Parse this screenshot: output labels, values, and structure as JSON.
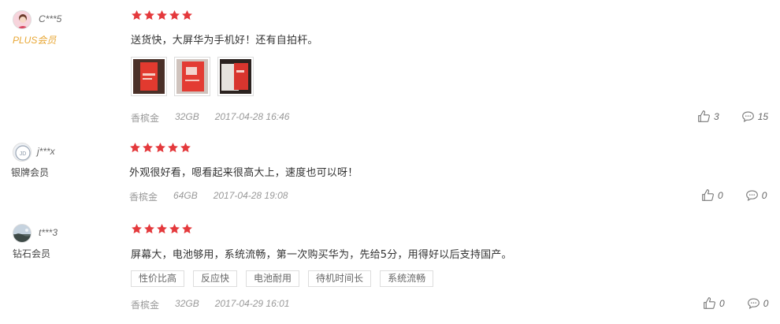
{
  "reviews": [
    {
      "username": "C***5",
      "level": "PLUS会员",
      "stars": 5,
      "comment": "送货快，大屏华为手机好！还有自拍杆。",
      "thumbnails": [
        "photo-1",
        "photo-2",
        "photo-3"
      ],
      "color": "香槟金",
      "storage": "32GB",
      "datetime": "2017-04-28 16:46",
      "likes": "3",
      "replies": "15"
    },
    {
      "username": "j***x",
      "level": "银牌会员",
      "stars": 5,
      "comment": "外观很好看，嗯看起来很高大上，速度也可以呀！",
      "color": "香槟金",
      "storage": "64GB",
      "datetime": "2017-04-28 19:08",
      "likes": "0",
      "replies": "0"
    },
    {
      "username": "t***3",
      "level": "钻石会员",
      "stars": 5,
      "comment": "屏幕大，电池够用，系统流畅，第一次购买华为，先给5分，用得好以后支持国产。",
      "tags": [
        "性价比高",
        "反应快",
        "电池耐用",
        "待机时间长",
        "系统流畅"
      ],
      "color": "香槟金",
      "storage": "32GB",
      "datetime": "2017-04-29 16:01",
      "likes": "0",
      "replies": "0"
    }
  ],
  "colors": {
    "star": "#e4393c",
    "plus_level": "#e8a735",
    "meta": "#999999"
  }
}
